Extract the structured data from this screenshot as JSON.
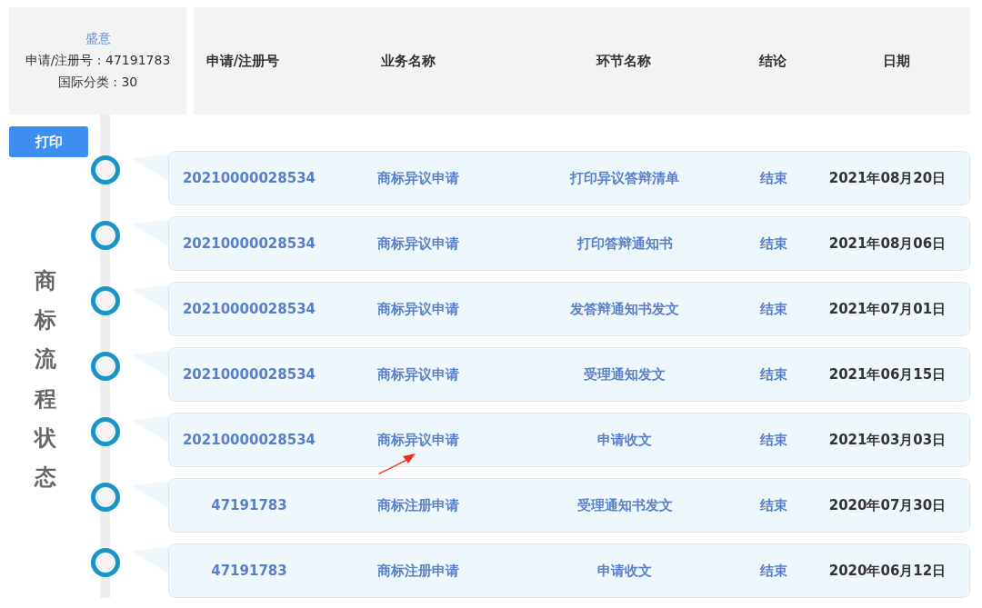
{
  "mark": {
    "name": "盛意",
    "reg_label": "申请/注册号 : 47191783",
    "class_label": "国际分类 : 30"
  },
  "columns": [
    "申请/注册号",
    "业务名称",
    "环节名称",
    "结论",
    "日期"
  ],
  "print_button": "打印",
  "side_label": "商标流程状态",
  "rows": [
    {
      "number": "20210000028534",
      "business": "商标异议申请",
      "step": "打印异议答辩清单",
      "result": "结束",
      "date": "2021年08月20日",
      "annotated": false
    },
    {
      "number": "20210000028534",
      "business": "商标异议申请",
      "step": "打印答辩通知书",
      "result": "结束",
      "date": "2021年08月06日",
      "annotated": false
    },
    {
      "number": "20210000028534",
      "business": "商标异议申请",
      "step": "发答辩通知书发文",
      "result": "结束",
      "date": "2021年07月01日",
      "annotated": false
    },
    {
      "number": "20210000028534",
      "business": "商标异议申请",
      "step": "受理通知发文",
      "result": "结束",
      "date": "2021年06月15日",
      "annotated": false
    },
    {
      "number": "20210000028534",
      "business": "商标异议申请",
      "step": "申请收文",
      "result": "结束",
      "date": "2021年03月03日",
      "annotated": true
    },
    {
      "number": "47191783",
      "business": "商标注册申请",
      "step": "受理通知书发文",
      "result": "结束",
      "date": "2020年07月30日",
      "annotated": false
    },
    {
      "number": "47191783",
      "business": "商标注册申请",
      "step": "申请收文",
      "result": "结束",
      "date": "2020年06月12日",
      "annotated": false
    }
  ]
}
